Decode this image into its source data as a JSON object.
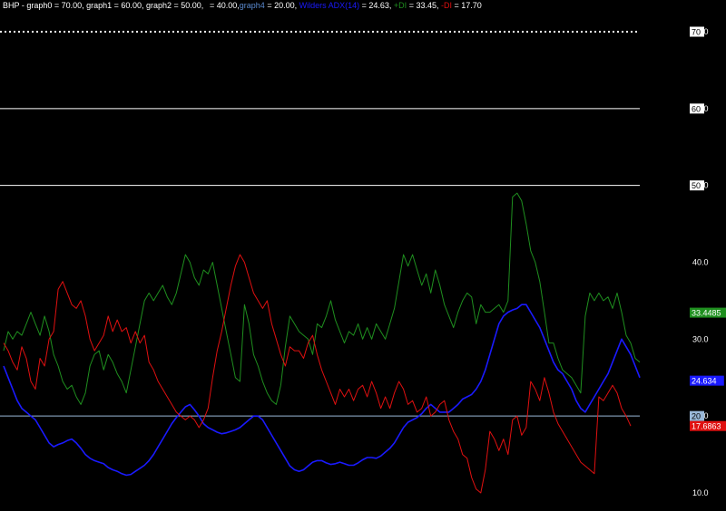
{
  "header": {
    "symbol": "BHP",
    "graph0_text": " - graph0 = 70.00, graph1 = 60.00, graph2 = 50.00,",
    "graph3_text": "= 40.00,",
    "graph4_name": "graph4",
    "graph4_text": " = 20.00,",
    "adx_name": "Wilders ADX(14)",
    "adx_text": " = 24.63,",
    "pdi_name": "+DI",
    "pdi_text": " = 33.45,",
    "mdi_name": "-DI",
    "mdi_text": " = 17.70"
  },
  "colors": {
    "background": "#000000",
    "adx": "#1a1aff",
    "pdi": "#1f8f1f",
    "mdi": "#e01010",
    "ref_line": "#ffffff",
    "ref20": "#9ab8d8"
  },
  "chart_data": {
    "type": "line",
    "ylim": [
      8,
      72
    ],
    "y_ticks": [
      "70.0",
      "60.0",
      "50.0",
      "40.0",
      "30.0",
      "20.0",
      "10.0"
    ],
    "x": [
      0,
      1,
      2,
      3,
      4,
      5,
      6,
      7,
      8,
      9,
      10,
      11,
      12,
      13,
      14,
      15,
      16,
      17,
      18,
      19,
      20,
      21,
      22,
      23,
      24,
      25,
      26,
      27,
      28,
      29,
      30,
      31,
      32,
      33,
      34,
      35,
      36,
      37,
      38,
      39,
      40,
      41,
      42,
      43,
      44,
      45,
      46,
      47,
      48,
      49,
      50,
      51,
      52,
      53,
      54,
      55,
      56,
      57,
      58,
      59,
      60,
      61,
      62,
      63,
      64,
      65,
      66,
      67,
      68,
      69,
      70,
      71,
      72,
      73,
      74,
      75,
      76,
      77,
      78,
      79,
      80,
      81,
      82,
      83,
      84,
      85,
      86,
      87,
      88,
      89,
      90,
      91,
      92,
      93,
      94,
      95,
      96,
      97,
      98,
      99,
      100,
      101,
      102,
      103,
      104,
      105,
      106,
      107,
      108,
      109,
      110,
      111,
      112,
      113,
      114,
      115,
      116,
      117,
      118,
      119,
      120,
      121,
      122,
      123,
      124,
      125,
      126,
      127,
      128,
      129,
      130,
      131,
      132,
      133,
      134,
      135,
      136,
      137,
      138,
      139,
      140
    ],
    "reference_lines": [
      {
        "value": 70,
        "label": "70",
        "style": "dotted"
      },
      {
        "value": 60,
        "label": "60",
        "style": "solid"
      },
      {
        "value": 50,
        "label": "50",
        "style": "solid"
      },
      {
        "value": 20,
        "label": "20",
        "style": "solid"
      }
    ],
    "series": [
      {
        "name": "Wilders ADX(14)",
        "last_label": "24.634",
        "values": [
          26.5,
          25,
          23.5,
          22,
          21,
          20.5,
          20,
          19.5,
          18.5,
          17.5,
          16.5,
          16,
          16.3,
          16.5,
          16.8,
          17,
          16.5,
          15.8,
          15,
          14.5,
          14.2,
          14,
          13.8,
          13.3,
          13,
          12.8,
          12.5,
          12.3,
          12.4,
          12.8,
          13.2,
          13.6,
          14.2,
          15,
          16,
          17,
          18,
          19,
          19.8,
          20.5,
          21.2,
          21.5,
          20.8,
          20,
          19,
          18.5,
          18.2,
          17.9,
          17.7,
          17.8,
          18,
          18.2,
          18.5,
          19,
          19.5,
          20,
          20,
          19.5,
          18.5,
          17.5,
          16.5,
          15.5,
          14.5,
          13.5,
          13,
          12.8,
          13,
          13.5,
          14,
          14.2,
          14.2,
          13.9,
          13.7,
          13.8,
          14,
          13.8,
          13.6,
          13.6,
          13.9,
          14.3,
          14.6,
          14.6,
          14.5,
          14.8,
          15.3,
          15.8,
          16.5,
          17.5,
          18.5,
          19.2,
          19.5,
          19.8,
          20.3,
          21,
          21.5,
          21,
          20.5,
          20.5,
          20.5,
          21,
          21.5,
          22.2,
          22.5,
          22.8,
          23.5,
          24.5,
          26,
          28,
          30,
          32,
          33,
          33.5,
          33.8,
          34,
          34.5,
          34.5,
          33.5,
          32.5,
          31.5,
          30,
          28.5,
          27,
          26,
          25.5,
          24.5,
          23.5,
          22,
          21,
          20.5,
          21.5,
          22.5,
          23.5,
          24.5,
          25.5,
          27,
          28.5,
          30,
          29,
          28,
          26.5,
          25,
          24,
          23.6,
          24.6
        ]
      },
      {
        "name": "+DI",
        "last_label": "33.4485",
        "values": [
          28.5,
          31,
          30,
          31,
          30.5,
          32,
          33.5,
          32,
          30.5,
          33,
          31,
          28,
          26.5,
          24.5,
          23.5,
          24,
          22.5,
          21.5,
          23,
          26.5,
          28,
          28.5,
          26,
          28,
          27,
          25.5,
          24.5,
          23,
          26,
          29,
          32,
          35,
          36,
          35,
          36,
          37,
          35.5,
          34.5,
          36,
          38.5,
          41,
          40,
          38,
          37,
          39,
          38.5,
          40,
          37,
          34,
          31,
          28,
          25,
          24.5,
          34.5,
          32,
          28,
          26.5,
          24.5,
          23,
          22,
          21.5,
          24,
          29,
          33,
          32,
          31,
          30.5,
          30,
          28,
          32,
          31.5,
          33,
          35,
          32.5,
          31,
          29.5,
          31,
          30.5,
          32,
          30,
          31.5,
          30,
          32,
          31,
          30,
          32,
          34,
          37.5,
          41,
          39.5,
          41,
          39,
          37,
          38.5,
          36,
          39,
          37,
          34.5,
          33,
          31.5,
          33.5,
          35,
          36,
          35.5,
          32,
          34.5,
          33.5,
          33.5,
          34,
          34.5,
          33.5,
          35,
          48.5,
          49,
          48,
          45,
          41.5,
          40,
          37.5,
          33.5,
          29.5,
          29.5,
          27.5,
          26,
          25.5,
          25,
          24,
          23,
          33,
          36,
          35,
          36,
          35,
          35.5,
          34,
          36,
          33.5,
          30.5,
          29.5,
          27.5,
          27,
          30,
          34,
          33.4485
        ]
      },
      {
        "name": "-DI",
        "last_label": "17.6863",
        "values": [
          29.5,
          28.5,
          27,
          26,
          29,
          27.5,
          24.5,
          23.5,
          27.5,
          26.5,
          30,
          31,
          36.5,
          37.5,
          36,
          34.5,
          34,
          35,
          33,
          30,
          28.5,
          29.5,
          30.5,
          33,
          31,
          32.5,
          31,
          31.5,
          29.5,
          31,
          29.5,
          30.5,
          27,
          26,
          24.5,
          23.5,
          22.5,
          21.5,
          20.5,
          20,
          19.5,
          20,
          19.5,
          18.5,
          19.5,
          21,
          25,
          28.5,
          31,
          34,
          37,
          39.5,
          41,
          40,
          38,
          36,
          35,
          34,
          35,
          32,
          30,
          28,
          26.5,
          29,
          28.5,
          28.5,
          27.5,
          29.5,
          30.5,
          28,
          26,
          24.5,
          23,
          21.5,
          23.5,
          22.5,
          23.5,
          22,
          23.5,
          24,
          22.5,
          24.5,
          23,
          21,
          22.5,
          21,
          23,
          24.5,
          23.5,
          21.5,
          22,
          20.5,
          21,
          22.5,
          20,
          20.5,
          21.5,
          22,
          19.5,
          18,
          17,
          15,
          14.5,
          12,
          10.5,
          10,
          13,
          18,
          17,
          15.5,
          17,
          15,
          19.5,
          20,
          17.5,
          18.5,
          24.5,
          23.5,
          22,
          25,
          23,
          20.5,
          19,
          18,
          17,
          16,
          15,
          14,
          13.5,
          13,
          12.5,
          22.5,
          22,
          23,
          24,
          23,
          21,
          20,
          18.7
        ]
      }
    ]
  }
}
